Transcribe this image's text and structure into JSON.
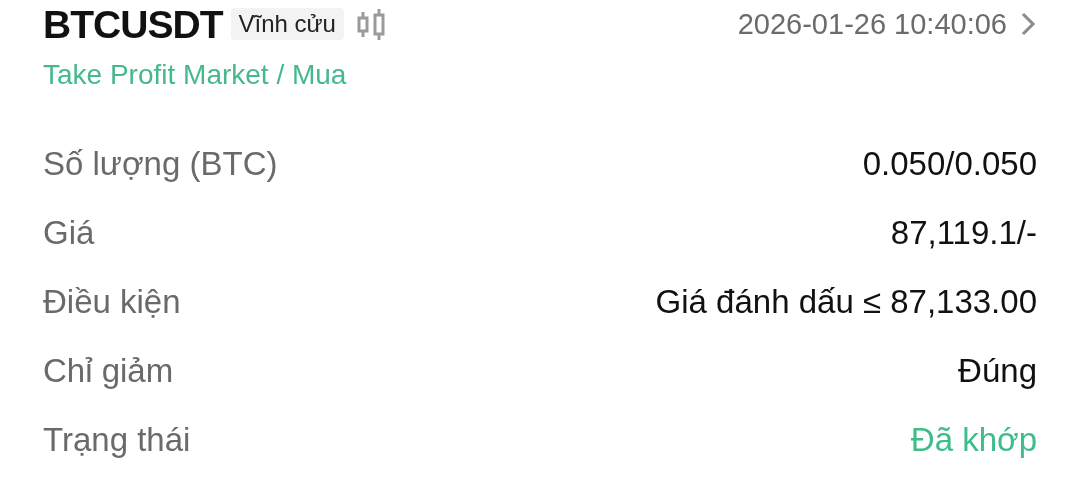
{
  "header": {
    "symbol": "BTCUSDT",
    "badge": "Vĩnh cửu",
    "time": "2026-01-26 10:40:06"
  },
  "order_type": "Take Profit Market / Mua",
  "details": [
    {
      "label": "Số lượng (BTC)",
      "value": "0.050/0.050",
      "kind": "plain"
    },
    {
      "label": "Giá",
      "value": "87,119.1/-",
      "kind": "plain"
    },
    {
      "label": "Điều kiện",
      "value": "Giá đánh dấu ≤ 87,133.00",
      "kind": "plain"
    },
    {
      "label": "Chỉ giảm",
      "value": "Đúng",
      "kind": "plain"
    },
    {
      "label": "Trạng thái",
      "value": "Đã khớp",
      "kind": "status"
    }
  ]
}
